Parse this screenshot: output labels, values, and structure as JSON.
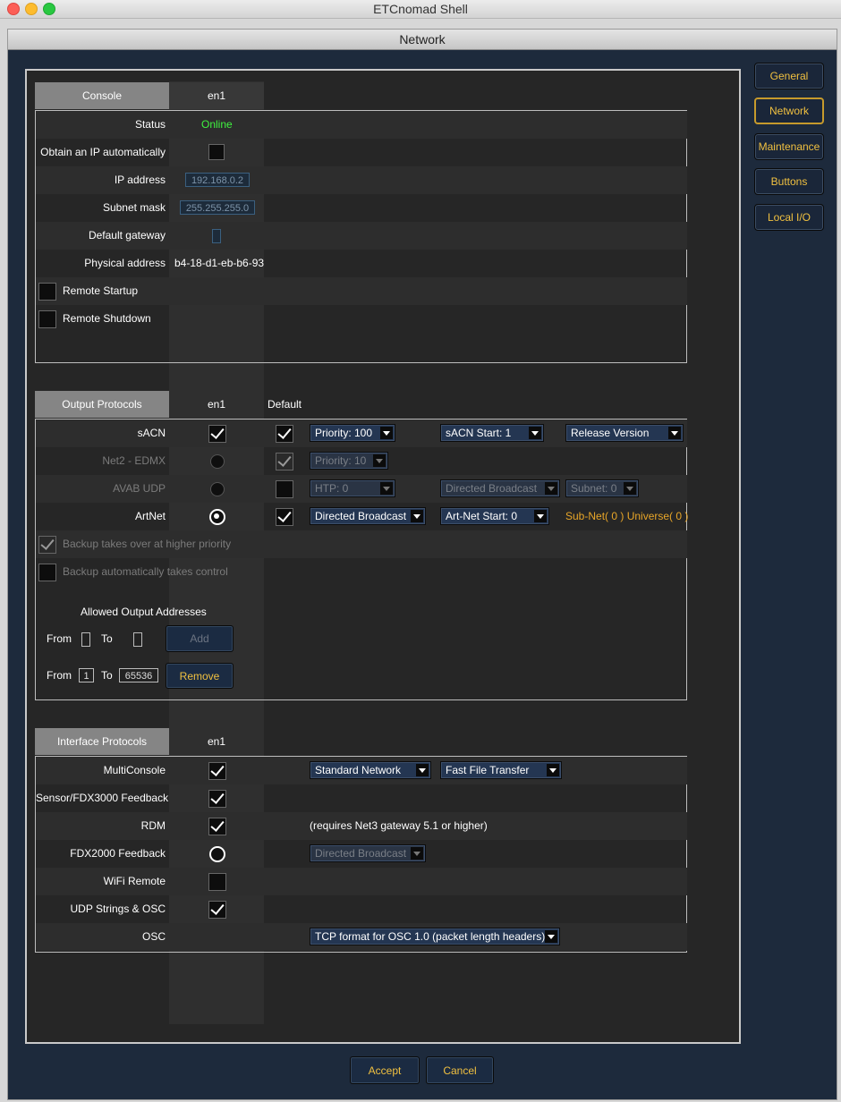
{
  "app_title": "ETCnomad Shell",
  "window_title": "Network",
  "sidebar": [
    "General",
    "Network",
    "Maintenance",
    "Buttons",
    "Local I/O"
  ],
  "console": {
    "header": "Console",
    "iface": "en1",
    "status_label": "Status",
    "status_value": "Online",
    "obtain_label": "Obtain an IP automatically",
    "ip_label": "IP address",
    "ip_value": "192.168.0.2",
    "subnet_label": "Subnet mask",
    "subnet_value": "255.255.255.0",
    "gateway_label": "Default gateway",
    "gateway_value": "",
    "physical_label": "Physical address",
    "physical_value": "b4-18-d1-eb-b6-93",
    "remote_startup": "Remote Startup",
    "remote_shutdown": "Remote Shutdown"
  },
  "output": {
    "header": "Output Protocols",
    "iface": "en1",
    "default_col": "Default",
    "sacn": {
      "label": "sACN",
      "priority": "Priority: 100",
      "start": "sACN Start: 1",
      "version": "Release Version"
    },
    "net2": {
      "label": "Net2 - EDMX",
      "priority": "Priority: 10"
    },
    "avab": {
      "label": "AVAB UDP",
      "htp": "HTP: 0",
      "mode": "Directed Broadcast",
      "subnet": "Subnet: 0"
    },
    "artnet": {
      "label": "ArtNet",
      "mode": "Directed Broadcast",
      "start": "Art-Net Start: 0",
      "subuni": "Sub-Net( 0 ) Universe( 0 )"
    },
    "backup_priority": "Backup takes over at higher priority",
    "backup_control": "Backup automatically takes control",
    "allowed_title": "Allowed Output Addresses",
    "from_label": "From",
    "to_label": "To",
    "from1": "",
    "to1": "",
    "add_label": "Add",
    "from2": "1",
    "to2": "65536",
    "remove_label": "Remove"
  },
  "interface": {
    "header": "Interface Protocols",
    "iface": "en1",
    "multiconsole": {
      "label": "MultiConsole",
      "network": "Standard Network",
      "transfer": "Fast File Transfer"
    },
    "sensor": {
      "label": "Sensor/FDX3000 Feedback"
    },
    "rdm": {
      "label": "RDM",
      "note": "(requires Net3 gateway 5.1 or higher)"
    },
    "fdx2000": {
      "label": "FDX2000 Feedback",
      "mode": "Directed Broadcast"
    },
    "wifi": {
      "label": "WiFi Remote"
    },
    "udp": {
      "label": "UDP Strings & OSC"
    },
    "osc": {
      "label": "OSC",
      "format": "TCP format for OSC 1.0 (packet length headers)"
    }
  },
  "footer": {
    "accept": "Accept",
    "cancel": "Cancel"
  }
}
